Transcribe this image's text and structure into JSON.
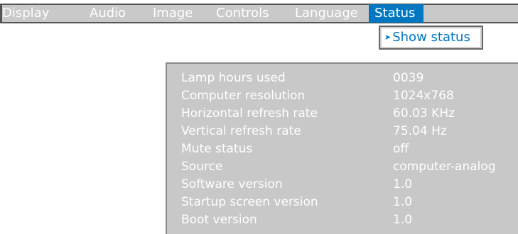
{
  "menubar": {
    "items": [
      {
        "label": "Display"
      },
      {
        "label": "Audio"
      },
      {
        "label": "Image"
      },
      {
        "label": "Controls"
      },
      {
        "label": "Language"
      },
      {
        "label": "Status"
      }
    ],
    "active_item": "Status"
  },
  "submenu": {
    "items": [
      {
        "label": "Show status",
        "selected": true
      }
    ]
  },
  "status": {
    "rows": [
      {
        "label": "Lamp hours used",
        "value": "0039"
      },
      {
        "label": "Computer resolution",
        "value": "1024x768"
      },
      {
        "label": "Horizontal refresh rate",
        "value": "60.03 KHz"
      },
      {
        "label": "Vertical refresh rate",
        "value": "75.04 Hz"
      },
      {
        "label": "Mute status",
        "value": "off"
      },
      {
        "label": "Source",
        "value": "computer-analog"
      },
      {
        "label": "Software version",
        "value": "1.0"
      },
      {
        "label": "Startup screen version",
        "value": "1.0"
      },
      {
        "label": "Boot version",
        "value": "1.0"
      }
    ]
  },
  "colors": {
    "accent": "#0077c0",
    "menu_background": "#c9c9c9",
    "panel_background": "#c8c8c8",
    "text_on_gray": "#ffffff"
  }
}
